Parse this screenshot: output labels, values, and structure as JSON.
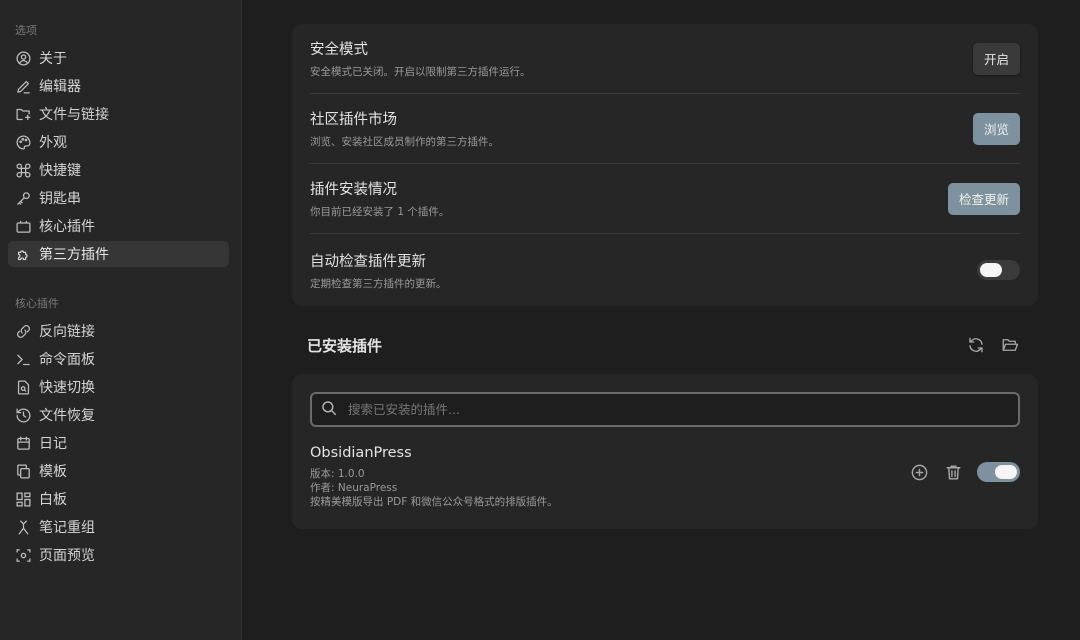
{
  "sidebar": {
    "options_title": "选项",
    "options": [
      {
        "label": "关于"
      },
      {
        "label": "编辑器"
      },
      {
        "label": "文件与链接"
      },
      {
        "label": "外观"
      },
      {
        "label": "快捷键"
      },
      {
        "label": "钥匙串"
      },
      {
        "label": "核心插件"
      },
      {
        "label": "第三方插件"
      }
    ],
    "core_title": "核心插件",
    "core": [
      {
        "label": "反向链接"
      },
      {
        "label": "命令面板"
      },
      {
        "label": "快速切换"
      },
      {
        "label": "文件恢复"
      },
      {
        "label": "日记"
      },
      {
        "label": "模板"
      },
      {
        "label": "白板"
      },
      {
        "label": "笔记重组"
      },
      {
        "label": "页面预览"
      }
    ]
  },
  "settings": {
    "safe_mode": {
      "name": "安全模式",
      "desc": "安全模式已关闭。开启以限制第三方插件运行。",
      "button": "开启"
    },
    "community": {
      "name": "社区插件市场",
      "desc": "浏览、安装社区成员制作的第三方插件。",
      "button": "浏览"
    },
    "status": {
      "name": "插件安装情况",
      "desc": "你目前已经安装了 1 个插件。",
      "button": "检查更新"
    },
    "auto_check": {
      "name": "自动检查插件更新",
      "desc": "定期检查第三方插件的更新。",
      "enabled": false
    }
  },
  "installed": {
    "title": "已安装插件",
    "search_placeholder": "搜索已安装的插件...",
    "plugins": [
      {
        "name": "ObsidianPress",
        "version": "版本: 1.0.0",
        "author": "作者: NeuraPress",
        "description": "按精美模版导出 PDF 和微信公众号格式的排版插件。",
        "enabled": true
      }
    ]
  },
  "colors": {
    "accent": "#7d929e",
    "background": "#1e1e1e",
    "card": "#262626"
  }
}
